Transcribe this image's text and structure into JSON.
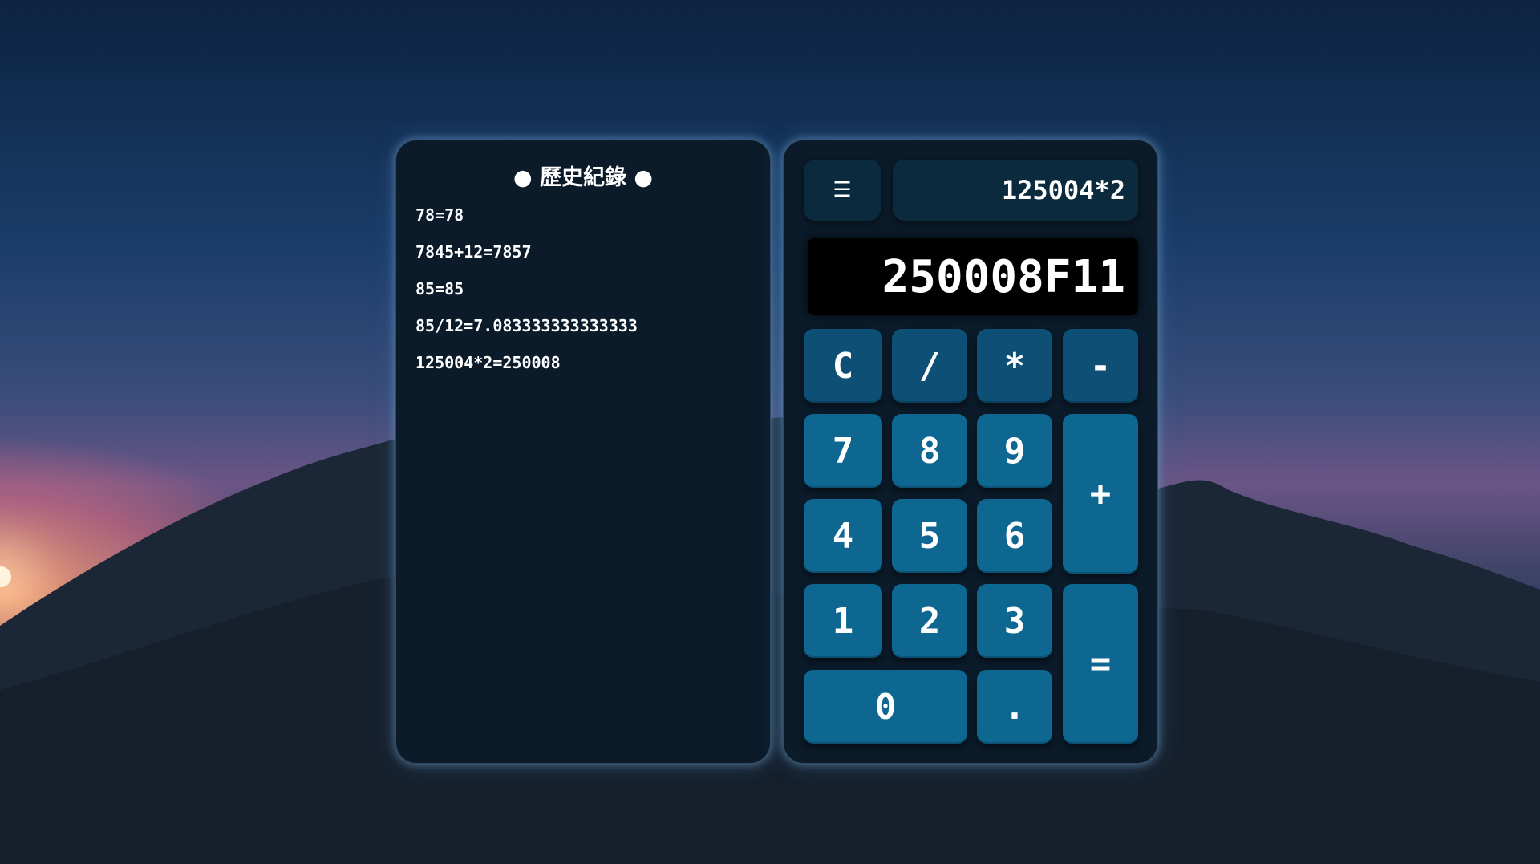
{
  "history": {
    "title": "● 歷史紀錄 ●",
    "entries": [
      "78=78",
      "7845+12=7857",
      "85=85",
      "85/12=7.083333333333333",
      "125004*2=250008"
    ]
  },
  "calculator": {
    "menu_label": "☰",
    "expression": "125004*2",
    "display": "250008F11",
    "keys": {
      "clear": "C",
      "divide": "/",
      "multiply": "*",
      "minus": "-",
      "seven": "7",
      "eight": "8",
      "nine": "9",
      "plus": "+",
      "four": "4",
      "five": "5",
      "six": "6",
      "one": "1",
      "two": "2",
      "three": "3",
      "equals": "=",
      "zero": "0",
      "dot": "."
    }
  },
  "colors": {
    "panel_bg": "#0b1b2a",
    "number_key": "#0e6791",
    "operator_key": "#0d4f75",
    "display_bg": "#000000"
  }
}
